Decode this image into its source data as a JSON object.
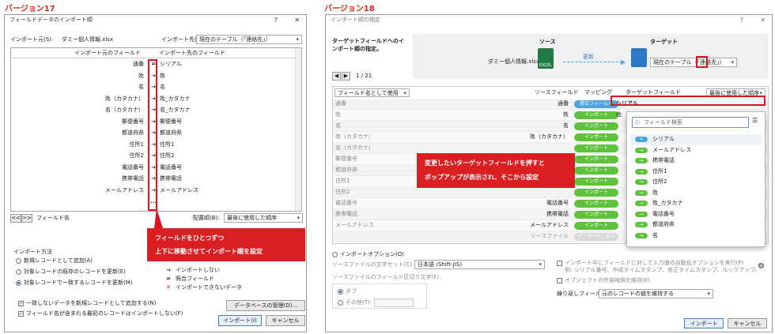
{
  "v17": {
    "version_label": "バージョン17",
    "title": "フィールドデータのインポート順",
    "help": "?",
    "close": "✕",
    "source_label": "インポート元(S):",
    "source_file": "ダミー個人情報.xlsx",
    "target_label": "インポート先(T):",
    "target_value": "現在のテーブル（「連絡先」）",
    "col_source": "インポート元のフィールド",
    "col_target": "インポート先のフィールド",
    "rows": [
      {
        "src": "通番",
        "arrow": "=",
        "dst": "シリアル"
      },
      {
        "src": "姓",
        "arrow": "→",
        "dst": "姓"
      },
      {
        "src": "名",
        "arrow": "→",
        "dst": "名"
      },
      {
        "src": "姓（カタカナ）",
        "arrow": "→",
        "dst": "姓_カタカナ"
      },
      {
        "src": "名（カタカナ）",
        "arrow": "→",
        "dst": "名_カタカナ"
      },
      {
        "src": "郵便番号",
        "arrow": "→",
        "dst": "郵便番号"
      },
      {
        "src": "都道府県",
        "arrow": "→",
        "dst": "都道府県"
      },
      {
        "src": "住所1",
        "arrow": "→",
        "dst": "住所1"
      },
      {
        "src": "住所2",
        "arrow": "→",
        "dst": "住所2"
      },
      {
        "src": "電話番号",
        "arrow": "→",
        "dst": "電話番号"
      },
      {
        "src": "携帯電話",
        "arrow": "→",
        "dst": "携帯電話"
      },
      {
        "src": "メールアドレス",
        "arrow": "→",
        "dst": "メールアドレス"
      },
      {
        "src": "",
        "arrow": "...",
        "dst": ""
      }
    ],
    "nav_prev": "<<",
    "nav_next": ">>",
    "field_name": "フィールド名",
    "order_label": "配置順(B):",
    "order_value": "最後に使用した順序",
    "callout_line1": "フィールドをひとつずつ",
    "callout_line2": "上下に移動させてインポート順を設定",
    "method_label": "インポート方法",
    "method_options": [
      "新規レコードとして追加(A)",
      "対象レコードの既存のレコードを更新(E)",
      "対象レコードで一致するレコードを更新(M)"
    ],
    "legend": [
      {
        "sym": "→",
        "text": "インポートしない"
      },
      {
        "sym": "=",
        "text": "照合フィールド"
      },
      {
        "sym": "✕",
        "text": "インポートできないデータ"
      }
    ],
    "check1": "一致しないデータを新規レコードとして追加する(N)",
    "check2": "フィールド名が含まれる最初のレコードはインポートしない(F)",
    "db_button": "データベースの管理(D)...",
    "import_button": "インポート(I)",
    "cancel_button": "キャンセル"
  },
  "v18": {
    "version_label": "バージョン18",
    "title": "インポート順の指定",
    "help": "?",
    "close": "✕",
    "instruction": "ターゲットフィールドへのインポート順の指定。",
    "source_head": "ソース",
    "target_head": "ターゲット",
    "source_file": "ダミー個人情報.xlsx",
    "excel_text": "EXCEL",
    "update_label": "更新",
    "target_value": "現在のテーブル（「連絡先」）",
    "page_counter": "1 / 21",
    "fieldname_select": "フィールド名として使用",
    "col_source": "ソースフィールド",
    "col_mapping": "マッピング",
    "col_target": "ターゲットフィールド",
    "order_value": "最後に使用した順序",
    "rows": [
      {
        "left": "通番",
        "src": "通番",
        "map": "照合フィールド",
        "dst": "シリアル"
      },
      {
        "left": "姓",
        "src": "姓",
        "map": "インポート",
        "dst": "姓"
      },
      {
        "left": "名",
        "src": "名",
        "map": "インポート",
        "dst": ""
      },
      {
        "left": "姓（カタカナ）",
        "src": "姓（カタカナ）",
        "map": "インポート",
        "dst": ""
      },
      {
        "left": "名（カタカナ）",
        "src": "",
        "map": "インポート",
        "dst": ""
      },
      {
        "left": "郵便番号",
        "src": "",
        "map": "インポート",
        "dst": ""
      },
      {
        "left": "都道府県",
        "src": "",
        "map": "インポート",
        "dst": ""
      },
      {
        "left": "住所1",
        "src": "",
        "map": "インポート",
        "dst": ""
      },
      {
        "left": "住所2",
        "src": "",
        "map": "インポート",
        "dst": ""
      },
      {
        "left": "電話番号",
        "src": "電話番号",
        "map": "インポート",
        "dst": ""
      },
      {
        "left": "携帯電話",
        "src": "携帯電話",
        "map": "インポート",
        "dst": ""
      },
      {
        "left": "メールアドレス",
        "src": "メールアドレス",
        "map": "インポート",
        "dst": ""
      },
      {
        "left": "",
        "src": "ソースファイル",
        "map": "インポートしない",
        "dst": ""
      }
    ],
    "popup_search": "フィールド検索",
    "popup_items": [
      {
        "sym": "=",
        "text": "シリアル"
      },
      {
        "sym": "→",
        "text": "メールアドレス"
      },
      {
        "sym": "→",
        "text": "携帯電話"
      },
      {
        "sym": "→",
        "text": "住所1"
      },
      {
        "sym": "→",
        "text": "住所2"
      },
      {
        "sym": "→",
        "text": "姓"
      },
      {
        "sym": "→",
        "text": "姓_カタカナ"
      },
      {
        "sym": "→",
        "text": "電話番号"
      },
      {
        "sym": "→",
        "text": "都道府県"
      },
      {
        "sym": "→",
        "text": "名"
      }
    ],
    "callout_line1": "変更したいターゲットフィールドを押すと",
    "callout_line2": "ポップアップが表示され、そこから設定",
    "options_label": "インポートオプション(O)",
    "charset_label": "ソースファイルの文字セット(C):",
    "charset_value": "日本語 (Shift-JIS)",
    "delim_label": "ソースファイルのフィールド区切り文字(F):",
    "delim_tab": "タブ",
    "delim_other": "その他(T):",
    "auto_enter": "インポート中にフィールドに対して入力値の自動化オプションを実行(P)",
    "auto_enter_ex": "例: シリアル番号、作成タイムスタンプ、修正タイムスタンプ、ルックアップ。",
    "keep_ext": "オブジェクトの外部格納を維持(E)",
    "repeat_label": "繰り返しフィールド(R):",
    "repeat_value": "元のレコードの値を維持する",
    "import_button": "インポート",
    "cancel_button": "キャンセル"
  },
  "colors": {
    "red": "#e0141c",
    "green": "#5fc23c",
    "blue": "#4ea3e0"
  }
}
